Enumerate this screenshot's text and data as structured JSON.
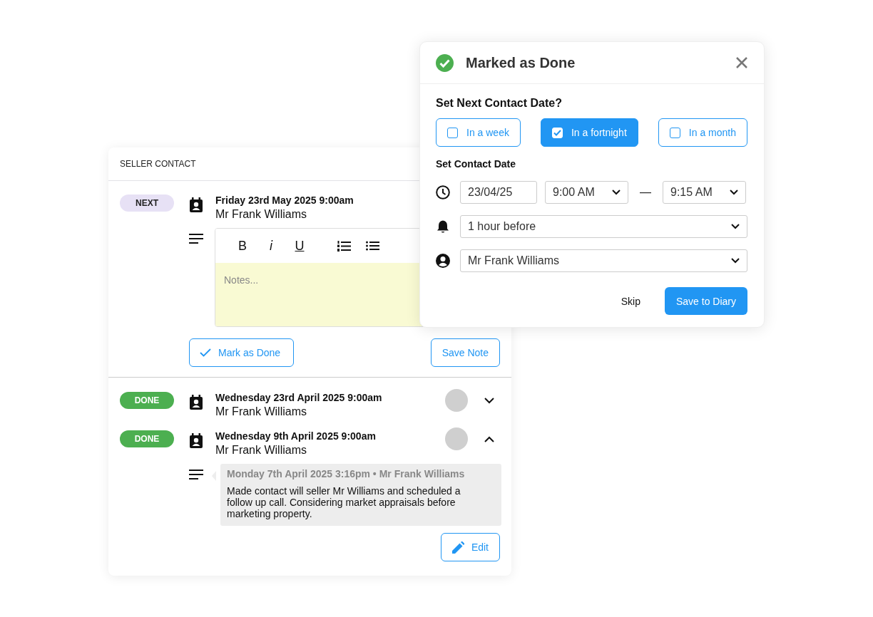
{
  "card": {
    "title": "SELLER CONTACT",
    "entries": [
      {
        "kind": "next",
        "badge": "NEXT",
        "date": "Friday 23rd May 2025 9:00am",
        "name": "Mr Frank Williams",
        "editor": {
          "tools": [
            {
              "kind": "bold",
              "label": "B"
            },
            {
              "kind": "italic",
              "label": "i"
            },
            {
              "kind": "underline",
              "label": "U"
            },
            {
              "kind": "numbered-list"
            },
            {
              "kind": "bullet-list"
            }
          ],
          "placeholder": "Notes...",
          "mark_button": "Mark as Done",
          "save_button": "Save Note"
        }
      },
      {
        "kind": "done",
        "badge": "DONE",
        "date": "Wednesday 23rd April 2025 9:00am",
        "name": "Mr Frank Williams",
        "expanded": false
      },
      {
        "kind": "done",
        "badge": "DONE",
        "date": "Wednesday 9th April 2025 9:00am",
        "name": "Mr Frank Williams",
        "expanded": true,
        "note": {
          "meta": "Monday 7th April 2025 3:16pm • Mr Frank Williams",
          "text": "Made contact will seller Mr Williams and scheduled a follow up call. Considering market appraisals before marketing property.",
          "button": "Edit"
        }
      }
    ]
  },
  "dialog": {
    "title": "Marked as Done",
    "question": "Set Next Contact Date?",
    "options": [
      {
        "label": "In a week",
        "selected": false
      },
      {
        "label": "In a fortnight",
        "selected": true
      },
      {
        "label": "In a month",
        "selected": false
      }
    ],
    "date_heading": "Set Contact Date",
    "date": "23/04/25",
    "start_time": "9:00 AM",
    "separator": "—",
    "end_time": "9:15 AM",
    "reminder": "1 hour before",
    "contact": "Mr Frank Williams",
    "skip": "Skip",
    "save": "Save to Diary"
  }
}
